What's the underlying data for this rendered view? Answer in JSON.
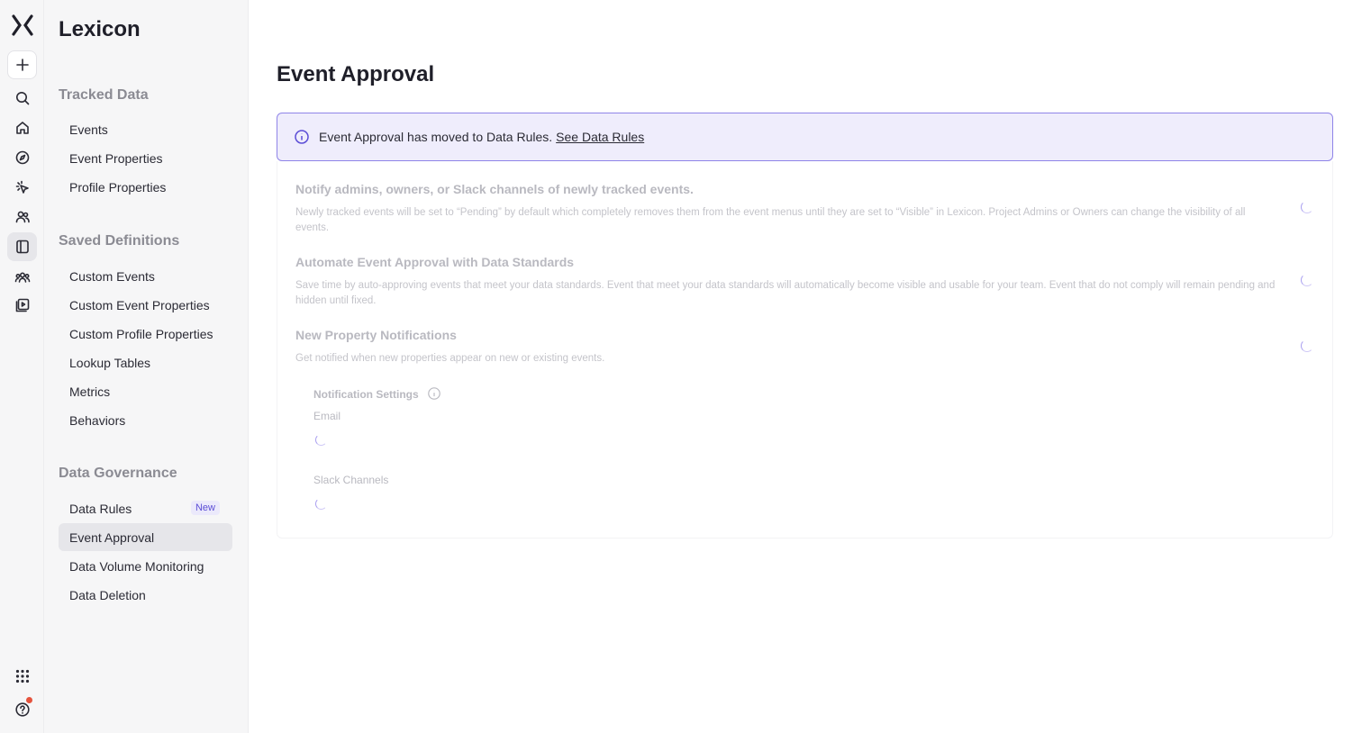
{
  "rail": {
    "logo": "mixpanel-logo-icon",
    "items": [
      "plus-icon",
      "search-icon",
      "home-icon",
      "compass-icon",
      "click-icon",
      "users-icon",
      "lexicon-icon",
      "cohorts-icon",
      "session-replay-icon",
      "apps-grid-icon",
      "help-icon"
    ]
  },
  "nav": {
    "title": "Lexicon",
    "sections": [
      {
        "label": "Tracked Data",
        "items": [
          "Events",
          "Event Properties",
          "Profile Properties"
        ]
      },
      {
        "label": "Saved Definitions",
        "items": [
          "Custom Events",
          "Custom Event Properties",
          "Custom Profile Properties",
          "Lookup Tables",
          "Metrics",
          "Behaviors"
        ]
      },
      {
        "label": "Data Governance",
        "items": [
          "Data Rules",
          "Event Approval",
          "Data Volume Monitoring",
          "Data Deletion"
        ]
      }
    ],
    "new_badge": "New",
    "selected": "Event Approval"
  },
  "main": {
    "title": "Event Approval",
    "banner": {
      "text": "Event Approval has moved to Data Rules.",
      "link": "See Data Rules",
      "accent": "#5b4dd6"
    },
    "settings": [
      {
        "title": "Notify admins, owners, or Slack channels of newly tracked events.",
        "desc": "Newly tracked events will be set to “Pending” by default which completely removes them from the event menus until they are set to “Visible” in Lexicon. Project Admins or Owners can change the visibility of all events."
      },
      {
        "title": "Automate Event Approval with Data Standards",
        "desc": "Save time by auto-approving events that meet your data standards. Event that meet your data standards will automatically become visible and usable for your team. Event that do not comply will remain pending and hidden until fixed."
      },
      {
        "title": "New Property Notifications",
        "desc": "Get notified when new properties appear on new or existing events."
      }
    ],
    "notification_settings": {
      "label": "Notification Settings",
      "email_label": "Email",
      "slack_label": "Slack Channels"
    }
  }
}
